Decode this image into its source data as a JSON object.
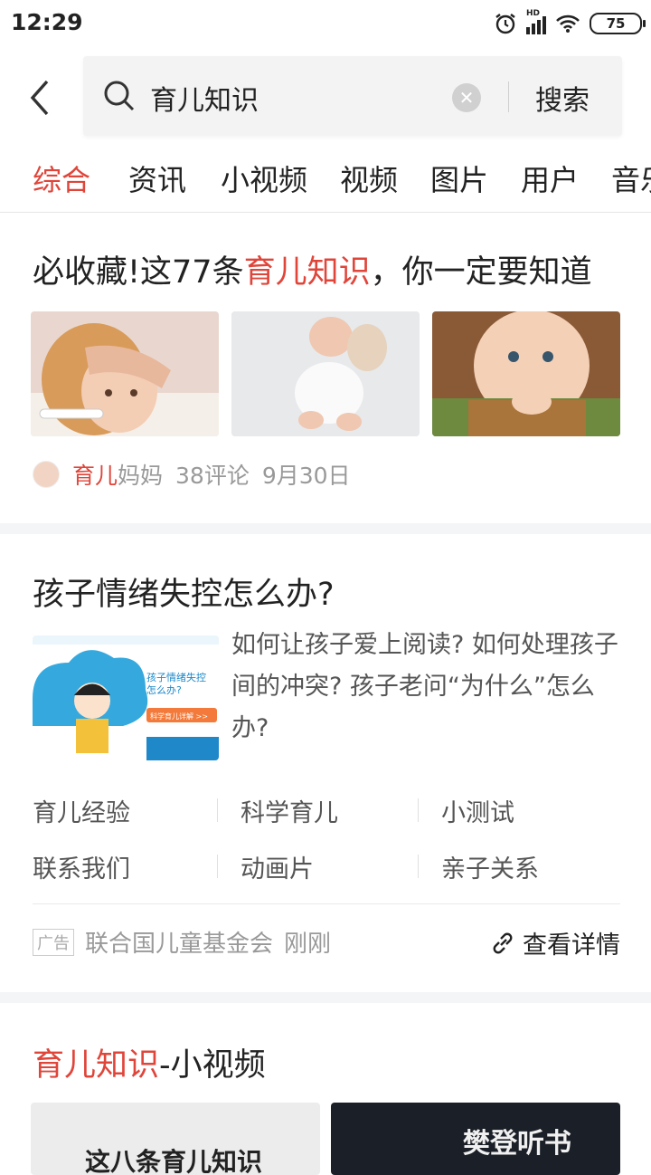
{
  "status": {
    "time": "12:29",
    "battery": "75",
    "network": "HD"
  },
  "search": {
    "query": "育儿知识",
    "button": "搜索"
  },
  "tabs": [
    "综合",
    "资讯",
    "小视频",
    "视频",
    "图片",
    "用户",
    "音乐"
  ],
  "result1": {
    "title_prefix": "必收藏!这77条",
    "title_highlight": "育儿知识",
    "title_suffix": "，你一定要知道",
    "author_highlight": "育儿",
    "author_rest": "妈妈",
    "comments": "38评论",
    "date": "9月30日"
  },
  "ad": {
    "title": "孩子情绪失控怎么办?",
    "description": "如何让孩子爱上阅读? 如何处理孩子间的冲突? 孩子老问“为什么”怎么办?",
    "image_text": {
      "line1": "孩子情绪失控",
      "line2": "怎么办?",
      "badge": "科学育儿详解 >>"
    },
    "links": [
      "育儿经验",
      "科学育儿",
      "小测试",
      "联系我们",
      "动画片",
      "亲子关系"
    ],
    "tag": "广告",
    "source": "联合国儿童基金会",
    "time": "刚刚",
    "details": "查看详情"
  },
  "section3": {
    "title_highlight": "育儿知识",
    "title_rest": "-小视频",
    "video1_text": "这八条育儿知识",
    "video2_text": "樊登听书"
  },
  "colors": {
    "accent": "#e0453a"
  }
}
